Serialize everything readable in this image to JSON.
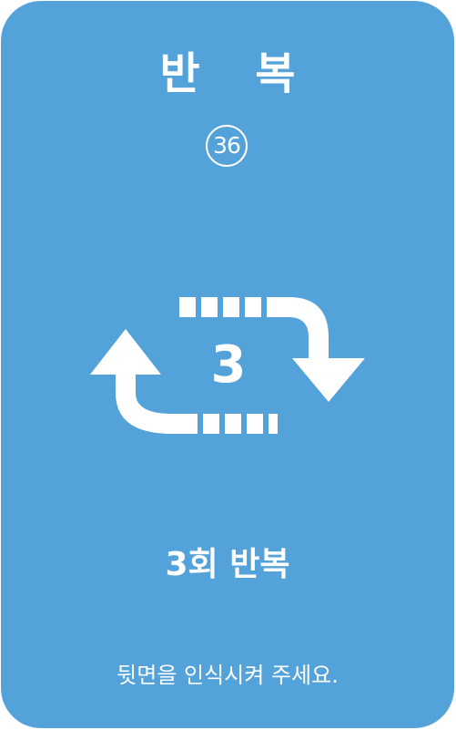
{
  "card": {
    "title": "반 복",
    "number": "36",
    "repeat_count": "3",
    "caption": "3회 반복",
    "hint": "뒷면을 인식시켜 주세요.",
    "icon": "repeat-loop-icon",
    "background_color": "#53a2d9",
    "foreground_color": "#ffffff"
  }
}
